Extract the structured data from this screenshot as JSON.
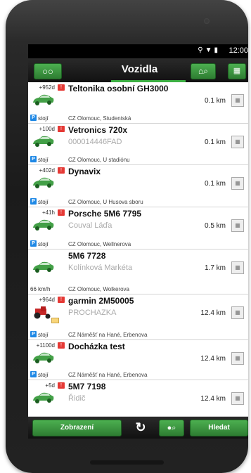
{
  "status_bar": {
    "time": "12:00",
    "icons": [
      "location-icon",
      "wifi-icon",
      "battery-icon"
    ]
  },
  "app_bar": {
    "title": "Vozidla",
    "left_icon": "cars-icon",
    "right_icons": [
      "home-search-icon",
      "map-icon"
    ]
  },
  "colors": {
    "accent": "#3cb043",
    "button": "#2e7d32",
    "alert": "#e53935",
    "parking": "#1e88e5"
  },
  "vehicles": [
    {
      "badge": "+952d",
      "alert": true,
      "name": "Teltonika osobní GH3000",
      "subtitle": "",
      "distance": "0.1 km",
      "state_prefix": "P",
      "state": "stojí",
      "address": "CZ Olomouc, Studentská"
    },
    {
      "badge": "+100d",
      "alert": true,
      "name": "Vetronics 720x",
      "subtitle": "000014446FAD",
      "distance": "0.1 km",
      "state_prefix": "P",
      "state": "stojí",
      "address": "CZ Olomouc, U stadiónu"
    },
    {
      "badge": "+402d",
      "alert": true,
      "name": "Dynavix",
      "subtitle": "",
      "distance": "0.1 km",
      "state_prefix": "P",
      "state": "stojí",
      "address": "CZ Olomouc, U Husova sboru"
    },
    {
      "badge": "+41h",
      "alert": true,
      "name": "Porsche 5M6 7795",
      "subtitle": "Couval Láďa",
      "distance": "0.5 km",
      "state_prefix": "P",
      "state": "stojí",
      "address": "CZ Olomouc, Wellnerova"
    },
    {
      "badge": "",
      "alert": false,
      "name": "5M6 7728",
      "subtitle": "Kolínková Markéta",
      "distance": "1.7 km",
      "speed": "66 km/h",
      "address": "CZ Olomouc, Wolkerova"
    },
    {
      "badge": "+964d",
      "alert": true,
      "name": "garmin 2M50005",
      "subtitle": "PROCHAZKA",
      "distance": "12.4 km",
      "state_prefix": "P",
      "state": "stojí",
      "address": "CZ Náměšť na Hané, Erbenova",
      "tractor": true
    },
    {
      "badge": "+1100d",
      "alert": true,
      "name": "Docházka test",
      "subtitle": "",
      "distance": "12.4 km",
      "state_prefix": "P",
      "state": "stojí",
      "address": "CZ Náměšť na Hané, Erbenova"
    },
    {
      "badge": "+5d",
      "alert": true,
      "name": "5M7 7198",
      "subtitle": "Řidič",
      "distance": "12.4 km",
      "state_prefix": "",
      "state": "",
      "address": ""
    }
  ],
  "bottom_bar": {
    "view_label": "Zobrazení",
    "search_label": "Hledat",
    "refresh_icon": "refresh-icon",
    "car_search_icon": "car-search-icon"
  }
}
